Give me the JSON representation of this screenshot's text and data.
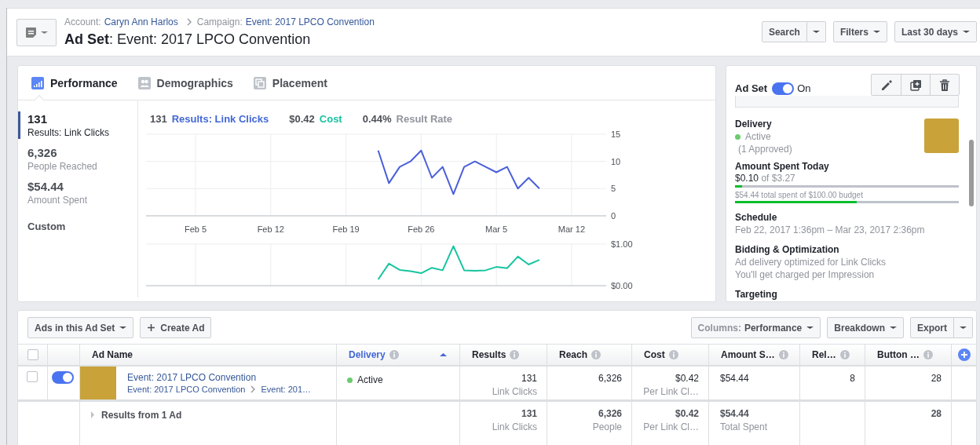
{
  "header": {
    "breadcrumb": [
      {
        "label": "Account:",
        "value": "Caryn Ann Harlos"
      },
      {
        "label": "Campaign:",
        "value": "Event: 2017 LPCO Convention"
      }
    ],
    "title": "**Ad Set**: Event: 2017 LPCO Convention",
    "buttons": [
      {
        "label": "Search",
        "kind": "split"
      },
      {
        "label": "Filters",
        "kind": "dropdown"
      },
      {
        "label": "Last 30 days",
        "kind": "dropdown"
      }
    ]
  },
  "tabs": [
    {
      "label": "Performance",
      "selected": true,
      "kind": "performance"
    },
    {
      "label": "Demographics",
      "selected": false,
      "kind": "demographics"
    },
    {
      "label": "Placement",
      "selected": false,
      "kind": "placement"
    }
  ],
  "metrics": [
    {
      "value": "131",
      "label": "Results: Link Clicks",
      "selected": true
    },
    {
      "value": "6,326",
      "label": "People Reached",
      "selected": false
    },
    {
      "value": "$54.44",
      "label": "Amount Spent",
      "selected": false
    }
  ],
  "custom_label": "Custom",
  "summary": [
    {
      "value": "131",
      "name": "Results: Link Clicks",
      "color": "#4267d6"
    },
    {
      "value": "$0.42",
      "name": "Cost",
      "color": "#17c4a0"
    },
    {
      "value": "0.44%",
      "name": "Result Rate",
      "color": "#90949c"
    }
  ],
  "results_chart": {
    "chart_data": {
      "type": "line",
      "grid": true,
      "categories": [
        null,
        null,
        null,
        "Feb 5",
        null,
        null,
        null,
        null,
        null,
        null,
        "Feb 12",
        null,
        null,
        null,
        null,
        null,
        null,
        "Feb 19",
        null,
        null,
        null,
        null,
        null,
        null,
        "Feb 26",
        null,
        null,
        null,
        null,
        null,
        null,
        "Mar 5",
        null,
        null,
        null,
        null,
        null,
        null,
        "Mar 12",
        null,
        null
      ],
      "series": [
        {
          "color": "#4a5fd9",
          "values": [
            null,
            null,
            null,
            null,
            null,
            null,
            null,
            null,
            null,
            null,
            null,
            null,
            null,
            null,
            null,
            null,
            null,
            null,
            null,
            null,
            12,
            6,
            9,
            10,
            12,
            7,
            9,
            4,
            9,
            10,
            9,
            8,
            9,
            5,
            7,
            5,
            null,
            null,
            null,
            null,
            null
          ]
        }
      ],
      "ylim": [
        0,
        15
      ],
      "yticks": [
        0,
        5,
        10,
        15
      ]
    }
  },
  "cost_chart": {
    "chart_data": {
      "type": "line",
      "grid": true,
      "categories": [
        null,
        null,
        null,
        null,
        null,
        null,
        null,
        null,
        null,
        null,
        null,
        null,
        null,
        null,
        null,
        null,
        null,
        null,
        null,
        null,
        null,
        null,
        null,
        null,
        null,
        null,
        null,
        null,
        null,
        null,
        null,
        null,
        null,
        null,
        null,
        null,
        null,
        null,
        null,
        null,
        null
      ],
      "series": [
        {
          "color": "#17c4a0",
          "values": [
            null,
            null,
            null,
            null,
            null,
            null,
            null,
            null,
            null,
            null,
            null,
            null,
            null,
            null,
            null,
            null,
            null,
            null,
            null,
            null,
            0.15,
            0.53,
            0.38,
            0.35,
            0.3,
            0.43,
            0.37,
            0.95,
            0.37,
            0.36,
            0.37,
            0.45,
            0.42,
            0.7,
            0.51,
            0.62,
            null,
            null,
            null,
            null,
            null
          ]
        }
      ],
      "ylim": [
        0,
        1
      ],
      "yticks": [
        {
          "value": 0,
          "label": "$0.00"
        },
        {
          "value": 1,
          "label": "$1.00"
        }
      ]
    }
  },
  "ad_set_panel": {
    "title": "Ad Set",
    "on": true,
    "status": "On",
    "sections": [
      {
        "kind": "delivery",
        "heading": "Delivery",
        "status": "Active",
        "note": "(1 Approved)"
      },
      {
        "kind": "spend",
        "heading": "Amount Spent Today",
        "amount": "$0.10",
        "of": "of $3.27",
        "level": 0.03
      },
      {
        "kind": "budget",
        "text": "$54.44 total spent of $100.00 budget",
        "level": 0.544
      },
      {
        "kind": "text",
        "heading": "Schedule",
        "lines": [
          "Feb 22, 2017 1:36pm – Mar 23, 2017 2:36pm"
        ]
      },
      {
        "kind": "text",
        "heading": "Bidding & Optimization",
        "lines": [
          "Ad delivery optimized for Link Clicks",
          "You'll get charged per Impression"
        ]
      },
      {
        "kind": "text",
        "heading": "Targeting"
      }
    ]
  },
  "toolbar": {
    "left": [
      {
        "label": "Ads in this Ad Set",
        "kind": "dropdown"
      },
      {
        "label": "Create Ad",
        "kind": "create"
      }
    ],
    "right": [
      {
        "prefix": "Columns:",
        "label": "Performance",
        "kind": "dropdown"
      },
      {
        "label": "Breakdown",
        "kind": "dropdown"
      },
      {
        "label": "Export",
        "kind": "split"
      }
    ]
  },
  "table": {
    "select_all": {
      "checked": false
    },
    "columns": [
      {
        "label": "Ad Name",
        "kind": "name",
        "info": false,
        "sorted": false
      },
      {
        "label": "Delivery",
        "kind": "status",
        "info": true,
        "sorted": true
      },
      {
        "label": "Results",
        "kind": "number",
        "info": true,
        "sorted": false
      },
      {
        "label": "Reach",
        "kind": "number",
        "info": true,
        "sorted": false
      },
      {
        "label": "Cost",
        "kind": "number",
        "info": true,
        "sorted": false
      },
      {
        "label": "Amount S…",
        "kind": "money",
        "info": true,
        "sorted": false
      },
      {
        "label": "Rel…",
        "kind": "number",
        "info": true,
        "sorted": false
      },
      {
        "label": "Button …",
        "kind": "number",
        "info": true,
        "sorted": false
      }
    ],
    "rows": [
      {
        "checked": false,
        "on": true,
        "cells": [
          {
            "value": "Event: 2017 LPCO Convention",
            "path": [
              "Event: 2017 LPCO Convention",
              "Event: 201…"
            ]
          },
          {
            "value": "Active"
          },
          {
            "value": "131",
            "sub": "Link Clicks"
          },
          {
            "value": "6,326"
          },
          {
            "value": "$0.42",
            "sub": "Per Link Cl…"
          },
          {
            "value": "$54.44"
          },
          {
            "value": "8"
          },
          {
            "value": "28"
          }
        ]
      }
    ],
    "total": {
      "cells": [
        {
          "value": "Results from 1 Ad"
        },
        {},
        {
          "value": "131",
          "sub": "Link Clicks"
        },
        {
          "value": "6,326",
          "sub": "People"
        },
        {
          "value": "$0.42",
          "sub": "Per Link Cl…"
        },
        {
          "value": "$54.44",
          "sub": "Total Spent"
        },
        {},
        {
          "value": "28"
        }
      ]
    }
  }
}
